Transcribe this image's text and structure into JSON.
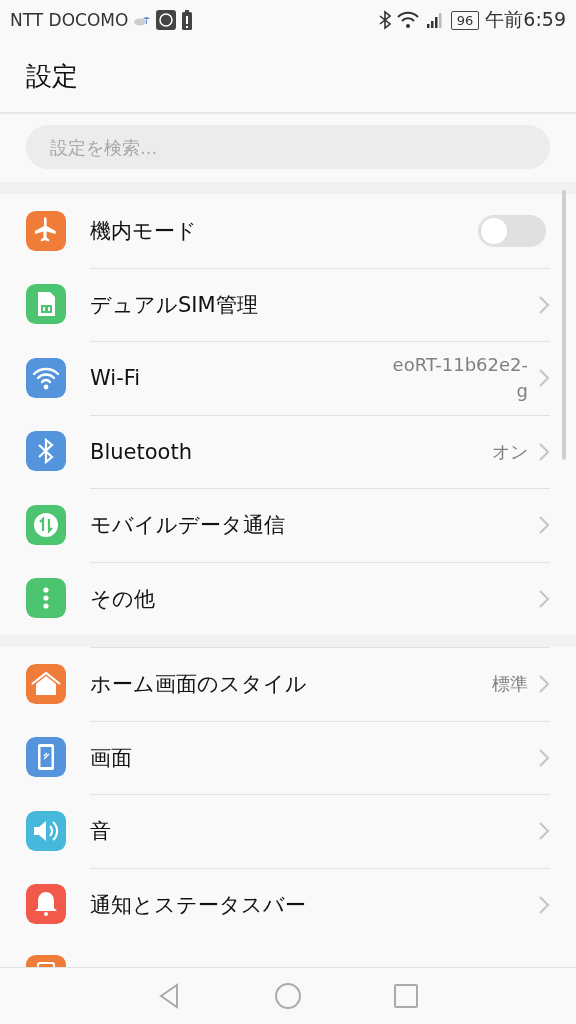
{
  "status_bar": {
    "carrier": "NTT DOCOMO",
    "battery": "96",
    "time": "午前6:59"
  },
  "title": "設定",
  "search": {
    "placeholder": "設定を検索..."
  },
  "groups": [
    {
      "items": [
        {
          "kind": "toggle",
          "color": "#f07c3a",
          "label": "機内モード",
          "on": false
        },
        {
          "kind": "nav",
          "color": "#4dc46f",
          "label": "デュアルSIM管理"
        },
        {
          "kind": "nav",
          "color": "#5394dc",
          "label": "Wi-Fi",
          "value": "eoRT-11b62e2-g"
        },
        {
          "kind": "nav",
          "color": "#5394dc",
          "label": "Bluetooth",
          "value": "オン"
        },
        {
          "kind": "nav",
          "color": "#4dc46f",
          "label": "モバイルデータ通信"
        },
        {
          "kind": "nav",
          "color": "#4dc46f",
          "label": "その他"
        }
      ]
    },
    {
      "items": [
        {
          "kind": "nav",
          "color": "#f07c3a",
          "label": "ホーム画面のスタイル",
          "value": "標準"
        },
        {
          "kind": "nav",
          "color": "#5394dc",
          "label": "画面"
        },
        {
          "kind": "nav",
          "color": "#45b8dc",
          "label": "音"
        },
        {
          "kind": "nav",
          "color": "#f2594b",
          "label": "通知とステータスバー"
        },
        {
          "kind": "partial",
          "color": "#f07c3a"
        }
      ]
    }
  ]
}
